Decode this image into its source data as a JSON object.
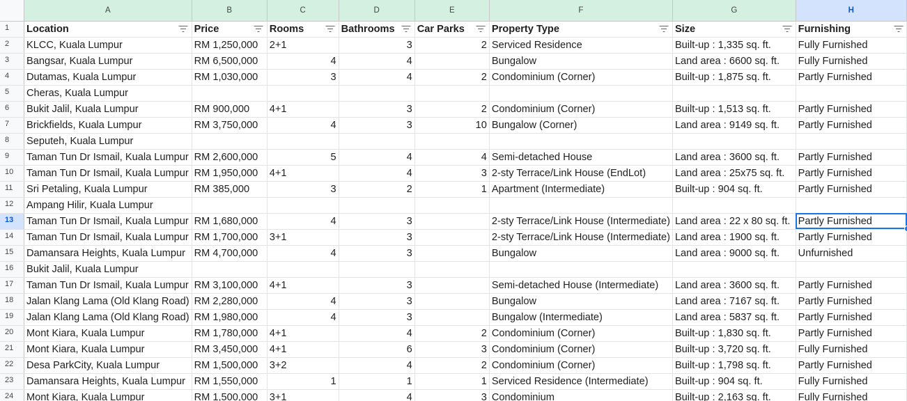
{
  "columns": [
    "A",
    "B",
    "C",
    "D",
    "E",
    "F",
    "G",
    "H"
  ],
  "selected_column": "H",
  "selected_row": "13",
  "headers": [
    "Location",
    "Price",
    "Rooms",
    "Bathrooms",
    "Car Parks",
    "Property Type",
    "Size",
    "Furnishing"
  ],
  "rows": [
    {
      "n": "2",
      "location": "KLCC, Kuala Lumpur",
      "price": "RM 1,250,000",
      "rooms": "2+1",
      "baths": "3",
      "parks": "2",
      "type": "Serviced Residence",
      "size": "Built-up : 1,335 sq. ft.",
      "furn": "Fully Furnished"
    },
    {
      "n": "3",
      "location": "Bangsar, Kuala Lumpur",
      "price": "RM 6,500,000",
      "rooms": "4",
      "baths": "4",
      "parks": "",
      "type": "Bungalow",
      "size": "Land area : 6600 sq. ft.",
      "furn": "Fully Furnished"
    },
    {
      "n": "4",
      "location": "Dutamas, Kuala Lumpur",
      "price": "RM 1,030,000",
      "rooms": "3",
      "baths": "4",
      "parks": "2",
      "type": "Condominium (Corner)",
      "size": "Built-up : 1,875 sq. ft.",
      "furn": "Partly Furnished"
    },
    {
      "n": "5",
      "location": "Cheras, Kuala Lumpur",
      "price": "",
      "rooms": "",
      "baths": "",
      "parks": "",
      "type": "",
      "size": "",
      "furn": ""
    },
    {
      "n": "6",
      "location": "Bukit Jalil, Kuala Lumpur",
      "price": "RM 900,000",
      "rooms": "4+1",
      "baths": "3",
      "parks": "2",
      "type": "Condominium (Corner)",
      "size": "Built-up : 1,513 sq. ft.",
      "furn": "Partly Furnished"
    },
    {
      "n": "7",
      "location": "Brickfields, Kuala Lumpur",
      "price": "RM 3,750,000",
      "rooms": "4",
      "baths": "3",
      "parks": "10",
      "type": "Bungalow (Corner)",
      "size": "Land area : 9149 sq. ft.",
      "furn": "Partly Furnished"
    },
    {
      "n": "8",
      "location": "Seputeh, Kuala Lumpur",
      "price": "",
      "rooms": "",
      "baths": "",
      "parks": "",
      "type": "",
      "size": "",
      "furn": ""
    },
    {
      "n": "9",
      "location": "Taman Tun Dr Ismail, Kuala Lumpur",
      "price": "RM 2,600,000",
      "rooms": "5",
      "baths": "4",
      "parks": "4",
      "type": "Semi-detached House",
      "size": "Land area : 3600 sq. ft.",
      "furn": "Partly Furnished"
    },
    {
      "n": "10",
      "location": "Taman Tun Dr Ismail, Kuala Lumpur",
      "price": "RM 1,950,000",
      "rooms": "4+1",
      "baths": "4",
      "parks": "3",
      "type": "2-sty Terrace/Link House (EndLot)",
      "size": "Land area : 25x75 sq. ft.",
      "furn": "Partly Furnished"
    },
    {
      "n": "11",
      "location": "Sri Petaling, Kuala Lumpur",
      "price": "RM 385,000",
      "rooms": "3",
      "baths": "2",
      "parks": "1",
      "type": "Apartment (Intermediate)",
      "size": "Built-up : 904 sq. ft.",
      "furn": "Partly Furnished"
    },
    {
      "n": "12",
      "location": "Ampang Hilir, Kuala Lumpur",
      "price": "",
      "rooms": "",
      "baths": "",
      "parks": "",
      "type": "",
      "size": "",
      "furn": ""
    },
    {
      "n": "13",
      "location": "Taman Tun Dr Ismail, Kuala Lumpur",
      "price": "RM 1,680,000",
      "rooms": "4",
      "baths": "3",
      "parks": "",
      "type": "2-sty Terrace/Link House (Intermediate)",
      "size": "Land area : 22 x 80 sq. ft.",
      "furn": "Partly Furnished"
    },
    {
      "n": "14",
      "location": "Taman Tun Dr Ismail, Kuala Lumpur",
      "price": "RM 1,700,000",
      "rooms": "3+1",
      "baths": "3",
      "parks": "",
      "type": "2-sty Terrace/Link House (Intermediate)",
      "size": "Land area : 1900 sq. ft.",
      "furn": "Partly Furnished"
    },
    {
      "n": "15",
      "location": "Damansara Heights, Kuala Lumpur",
      "price": "RM 4,700,000",
      "rooms": "4",
      "baths": "3",
      "parks": "",
      "type": "Bungalow",
      "size": "Land area : 9000 sq. ft.",
      "furn": "Unfurnished"
    },
    {
      "n": "16",
      "location": "Bukit Jalil, Kuala Lumpur",
      "price": "",
      "rooms": "",
      "baths": "",
      "parks": "",
      "type": "",
      "size": "",
      "furn": ""
    },
    {
      "n": "17",
      "location": "Taman Tun Dr Ismail, Kuala Lumpur",
      "price": "RM 3,100,000",
      "rooms": "4+1",
      "baths": "3",
      "parks": "",
      "type": "Semi-detached House (Intermediate)",
      "size": "Land area : 3600 sq. ft.",
      "furn": "Partly Furnished"
    },
    {
      "n": "18",
      "location": "Jalan Klang Lama (Old Klang Road)",
      "price": "RM 2,280,000",
      "rooms": "4",
      "baths": "3",
      "parks": "",
      "type": "Bungalow",
      "size": "Land area : 7167 sq. ft.",
      "furn": "Partly Furnished"
    },
    {
      "n": "19",
      "location": "Jalan Klang Lama (Old Klang Road)",
      "price": "RM 1,980,000",
      "rooms": "4",
      "baths": "3",
      "parks": "",
      "type": "Bungalow (Intermediate)",
      "size": "Land area : 5837 sq. ft.",
      "furn": "Partly Furnished"
    },
    {
      "n": "20",
      "location": "Mont Kiara, Kuala Lumpur",
      "price": "RM 1,780,000",
      "rooms": "4+1",
      "baths": "4",
      "parks": "2",
      "type": "Condominium (Corner)",
      "size": "Built-up : 1,830 sq. ft.",
      "furn": "Partly Furnished"
    },
    {
      "n": "21",
      "location": "Mont Kiara, Kuala Lumpur",
      "price": "RM 3,450,000",
      "rooms": "4+1",
      "baths": "6",
      "parks": "3",
      "type": "Condominium (Corner)",
      "size": "Built-up : 3,720 sq. ft.",
      "furn": "Fully Furnished"
    },
    {
      "n": "22",
      "location": "Desa ParkCity, Kuala Lumpur",
      "price": "RM 1,500,000",
      "rooms": "3+2",
      "baths": "4",
      "parks": "2",
      "type": "Condominium (Corner)",
      "size": "Built-up : 1,798 sq. ft.",
      "furn": "Partly Furnished"
    },
    {
      "n": "23",
      "location": "Damansara Heights, Kuala Lumpur",
      "price": "RM 1,550,000",
      "rooms": "1",
      "baths": "1",
      "parks": "1",
      "type": "Serviced Residence (Intermediate)",
      "size": "Built-up : 904 sq. ft.",
      "furn": "Fully Furnished"
    },
    {
      "n": "24",
      "location": "Mont Kiara, Kuala Lumpur",
      "price": "RM 1,500,000",
      "rooms": "3+1",
      "baths": "4",
      "parks": "3",
      "type": "Condominium",
      "size": "Built-up : 2,163 sq. ft.",
      "furn": "Fully Furnished"
    }
  ],
  "colors": {
    "col_header_bg": "#d3f0e0",
    "selection": "#1a73e8",
    "filter_icon": "#1e8e3e"
  }
}
